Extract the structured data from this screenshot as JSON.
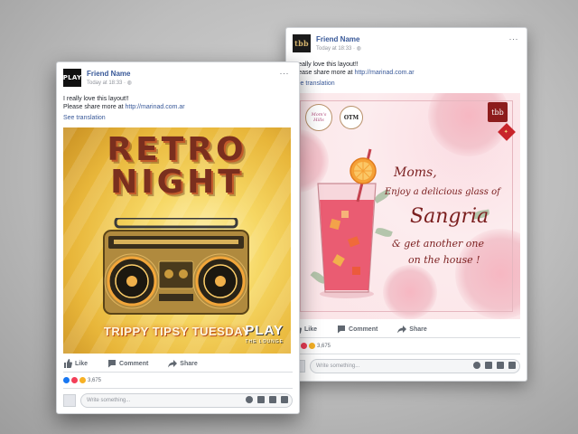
{
  "back_post": {
    "user_name": "Friend Name",
    "timestamp": "Today at 18:33 · ",
    "avatar_text": "tbb",
    "more": "···",
    "message_line1": "I really love this layout!!",
    "message_prefix": "Please share more at ",
    "link": "http://marinad.com.ar",
    "see_translation": "See translation",
    "ad": {
      "badge_left": "Mom's Hills",
      "badge_right": "OTM",
      "tile": "tbb",
      "line1": "Moms,",
      "line2": "Enjoy a delicious glass of",
      "line3": "Sangria",
      "line4": "& get another one",
      "line5": "on the house !"
    },
    "actions": {
      "like": "Like",
      "comment": "Comment",
      "share": "Share"
    },
    "reaction_count": "3,675",
    "comment_placeholder": "Write something..."
  },
  "front_post": {
    "user_name": "Friend Name",
    "timestamp": "Today at 18:33 · ",
    "avatar_text": "PLAY",
    "more": "···",
    "message_line1": "I really love this layout!!",
    "message_prefix": "Please share more at ",
    "link": "http://marinad.com.ar",
    "see_translation": "See translation",
    "poster": {
      "title_line1": "RETRO",
      "title_line2": "NIGHT",
      "subtitle": "TRIPPY TIPSY TUESDAY",
      "logo": "PLAY",
      "logo_sub": "THE LOUNGE"
    },
    "actions": {
      "like": "Like",
      "comment": "Comment",
      "share": "Share"
    },
    "reaction_count": "3,675",
    "comment_placeholder": "Write something..."
  },
  "colors": {
    "fb_link": "#385898",
    "like_blue": "#1877f2",
    "love_red": "#f33e58",
    "haha_yellow": "#f7b125",
    "retro_title": "#7a2f1e",
    "sangria_red": "#7b1f1f"
  }
}
